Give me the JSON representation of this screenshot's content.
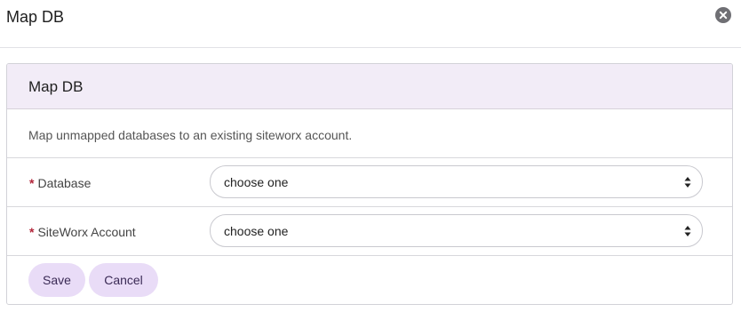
{
  "dialog": {
    "title": "Map DB",
    "close_icon": "close-icon"
  },
  "panel": {
    "title": "Map DB",
    "description": "Map unmapped databases to an existing siteworx account."
  },
  "fields": [
    {
      "required_mark": "*",
      "label": "Database",
      "value": "choose one"
    },
    {
      "required_mark": "*",
      "label": "SiteWorx Account",
      "value": "choose one"
    }
  ],
  "actions": {
    "save_label": "Save",
    "cancel_label": "Cancel"
  },
  "colors": {
    "panel_header_bg": "#f2ecf7",
    "button_bg": "#e9dcf7",
    "required": "#b3263a"
  }
}
